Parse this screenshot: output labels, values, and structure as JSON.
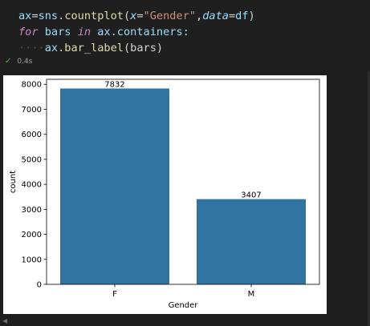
{
  "code": {
    "line1": {
      "var": "ax",
      "eq": "=",
      "module": "sns",
      "dot": ".",
      "func": "countplot",
      "open": "(",
      "param1": "x",
      "eq1": "=",
      "string": "\"Gender\"",
      "comma": ",",
      "param2": "data",
      "eq2": "=",
      "arg2": "df",
      "close": ")"
    },
    "line2": {
      "kw_for": "for",
      "var": "bars",
      "kw_in": "in",
      "obj": "ax",
      "attr": ".containers:"
    },
    "line3": {
      "indent": "····",
      "obj": "ax",
      "method": ".bar_label",
      "args": "(bars)"
    }
  },
  "status": {
    "icon": "check-icon",
    "time": "0.4s"
  },
  "chart_data": {
    "type": "bar",
    "categories": [
      "F",
      "M"
    ],
    "values": [
      7832,
      3407
    ],
    "bar_labels": [
      "7832",
      "3407"
    ],
    "xlabel": "Gender",
    "ylabel": "count",
    "ylim": [
      0,
      8200
    ],
    "yticks": [
      0,
      1000,
      2000,
      3000,
      4000,
      5000,
      6000,
      7000,
      8000
    ],
    "bar_color": "#3274a1",
    "grid": false
  }
}
